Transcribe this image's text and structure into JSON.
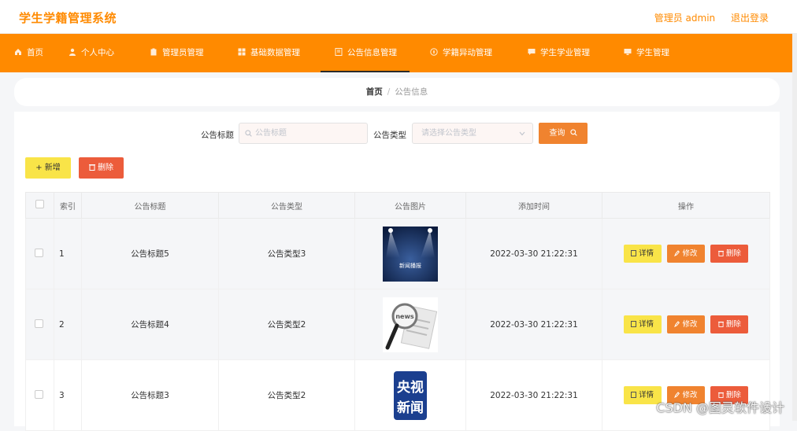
{
  "app": {
    "title": "学生学籍管理系统"
  },
  "header": {
    "user_label": "管理员 admin",
    "logout_label": "退出登录"
  },
  "nav": [
    {
      "label": "首页",
      "icon": "home-icon"
    },
    {
      "label": "个人中心",
      "icon": "user-icon"
    },
    {
      "label": "管理员管理",
      "icon": "clipboard-icon"
    },
    {
      "label": "基础数据管理",
      "icon": "grid-icon"
    },
    {
      "label": "公告信息管理",
      "icon": "doc-icon",
      "active": true
    },
    {
      "label": "学籍异动管理",
      "icon": "compass-icon"
    },
    {
      "label": "学生学业管理",
      "icon": "chat-icon"
    },
    {
      "label": "学生管理",
      "icon": "monitor-icon"
    }
  ],
  "breadcrumb": {
    "home": "首页",
    "separator": "/",
    "current": "公告信息"
  },
  "filters": {
    "title_label": "公告标题",
    "title_placeholder": "公告标题",
    "type_label": "公告类型",
    "type_placeholder": "请选择公告类型",
    "query_label": "查询"
  },
  "actions": {
    "add_label": "+ 新增",
    "delete_label": "删除"
  },
  "table": {
    "columns": [
      "索引",
      "公告标题",
      "公告类型",
      "公告图片",
      "添加时间",
      "操作"
    ],
    "rows": [
      {
        "index": "1",
        "title": "公告标题5",
        "type": "公告类型3",
        "image": "stage-lights",
        "time": "2022-03-30 21:22:31"
      },
      {
        "index": "2",
        "title": "公告标题4",
        "type": "公告类型2",
        "image": "news-magnifier",
        "time": "2022-03-30 21:22:31"
      },
      {
        "index": "3",
        "title": "公告标题3",
        "type": "公告类型2",
        "image": "cctv-news",
        "time": "2022-03-30 21:22:31"
      }
    ],
    "row_actions": {
      "detail": "详情",
      "edit": "修改",
      "delete": "删除"
    }
  },
  "images": {
    "stage_text": "新闻播报",
    "news_text": "news",
    "cctv_line1": "央视",
    "cctv_line2": "新闻"
  },
  "watermark": "CSDN @图灵软件设计",
  "colors": {
    "accent": "#ff8a00",
    "query": "#f0832f",
    "add": "#f9e448",
    "danger": "#ec5c3b"
  }
}
